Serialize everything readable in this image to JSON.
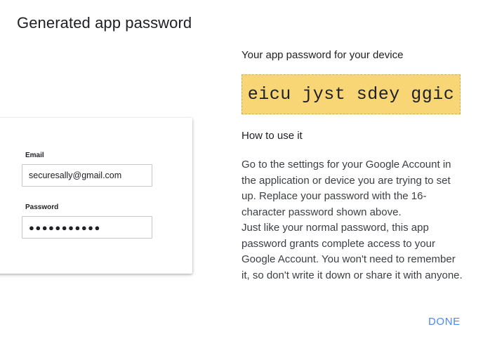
{
  "dialog": {
    "title": "Generated app password"
  },
  "login_illustration": {
    "email_label": "Email",
    "email_value": "securesally@gmail.com",
    "password_label": "Password",
    "password_value": "●●●●●●●●●●●"
  },
  "password_section": {
    "heading": "Your app password for your device",
    "password": "eicu jyst sdey ggic"
  },
  "how_to": {
    "heading": "How to use it",
    "paragraph1": "Go to the settings for your Google Account in the application or device you are trying to set up. Replace your password with the 16-character password shown above.",
    "paragraph2": "Just like your normal password, this app password grants complete access to your Google Account. You won't need to remember it, so don't write it down or share it with anyone."
  },
  "actions": {
    "done_label": "DONE"
  },
  "colors": {
    "password_box_bg": "#f8d675",
    "accent": "#4a8af4"
  }
}
